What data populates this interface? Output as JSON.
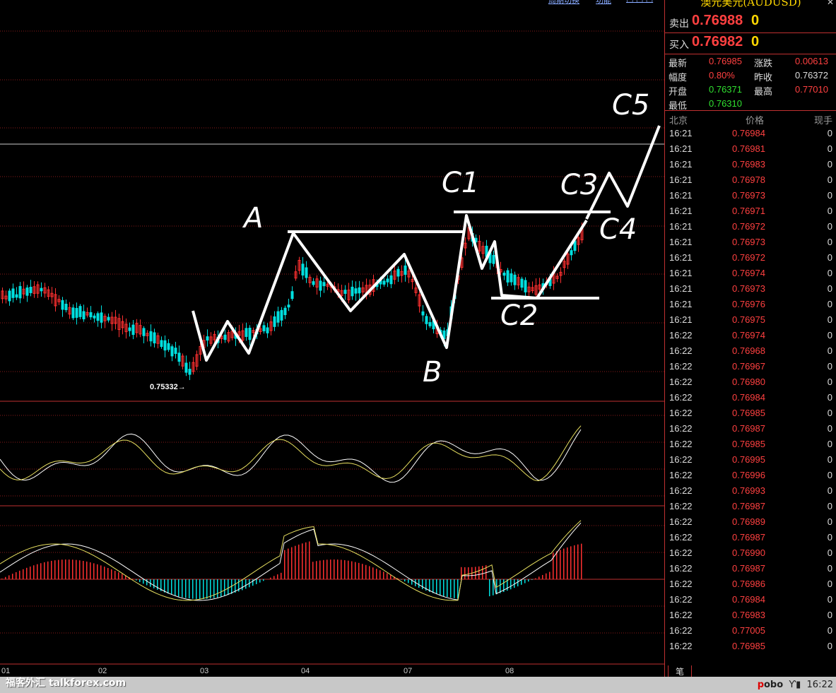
{
  "top_links": [
    "周期切换",
    "功能",
    "□ □ □"
  ],
  "right_panel": {
    "title": "澳元美元(AUDUSD)",
    "sell": {
      "label": "卖出",
      "price": "0.76988",
      "vol": "0"
    },
    "buy": {
      "label": "买入",
      "price": "0.76982",
      "vol": "0"
    },
    "stats": [
      {
        "l1": "最新",
        "v1": "0.76985",
        "c1": "#ff4040",
        "l2": "涨跌",
        "v2": "0.00613",
        "c2": "#ff4040"
      },
      {
        "l1": "幅度",
        "v1": "0.80%",
        "c1": "#ff4040",
        "l2": "昨收",
        "v2": "0.76372",
        "c2": "#dddddd"
      },
      {
        "l1": "开盘",
        "v1": "0.76371",
        "c1": "#30e030",
        "l2": "最高",
        "v2": "0.77010",
        "c2": "#ff4040"
      },
      {
        "l1": "最低",
        "v1": "0.76310",
        "c1": "#30e030",
        "l2": "",
        "v2": "",
        "c2": "#dddddd"
      }
    ],
    "ticks_header": {
      "time": "北京",
      "price": "价格",
      "vol": "现手"
    },
    "ticks": [
      {
        "t": "16:21",
        "p": "0.76984",
        "v": "0"
      },
      {
        "t": "16:21",
        "p": "0.76981",
        "v": "0"
      },
      {
        "t": "16:21",
        "p": "0.76983",
        "v": "0"
      },
      {
        "t": "16:21",
        "p": "0.76978",
        "v": "0"
      },
      {
        "t": "16:21",
        "p": "0.76973",
        "v": "0"
      },
      {
        "t": "16:21",
        "p": "0.76971",
        "v": "0"
      },
      {
        "t": "16:21",
        "p": "0.76972",
        "v": "0"
      },
      {
        "t": "16:21",
        "p": "0.76973",
        "v": "0"
      },
      {
        "t": "16:21",
        "p": "0.76972",
        "v": "0"
      },
      {
        "t": "16:21",
        "p": "0.76974",
        "v": "0"
      },
      {
        "t": "16:21",
        "p": "0.76973",
        "v": "0"
      },
      {
        "t": "16:21",
        "p": "0.76976",
        "v": "0"
      },
      {
        "t": "16:21",
        "p": "0.76975",
        "v": "0"
      },
      {
        "t": "16:22",
        "p": "0.76974",
        "v": "0"
      },
      {
        "t": "16:22",
        "p": "0.76968",
        "v": "0"
      },
      {
        "t": "16:22",
        "p": "0.76967",
        "v": "0"
      },
      {
        "t": "16:22",
        "p": "0.76980",
        "v": "0"
      },
      {
        "t": "16:22",
        "p": "0.76984",
        "v": "0"
      },
      {
        "t": "16:22",
        "p": "0.76985",
        "v": "0"
      },
      {
        "t": "16:22",
        "p": "0.76987",
        "v": "0"
      },
      {
        "t": "16:22",
        "p": "0.76985",
        "v": "0"
      },
      {
        "t": "16:22",
        "p": "0.76995",
        "v": "0"
      },
      {
        "t": "16:22",
        "p": "0.76996",
        "v": "0"
      },
      {
        "t": "16:22",
        "p": "0.76993",
        "v": "0"
      },
      {
        "t": "16:22",
        "p": "0.76987",
        "v": "0"
      },
      {
        "t": "16:22",
        "p": "0.76989",
        "v": "0"
      },
      {
        "t": "16:22",
        "p": "0.76987",
        "v": "0"
      },
      {
        "t": "16:22",
        "p": "0.76990",
        "v": "0"
      },
      {
        "t": "16:22",
        "p": "0.76987",
        "v": "0"
      },
      {
        "t": "16:22",
        "p": "0.76986",
        "v": "0"
      },
      {
        "t": "16:22",
        "p": "0.76984",
        "v": "0"
      },
      {
        "t": "16:22",
        "p": "0.76983",
        "v": "0"
      },
      {
        "t": "16:22",
        "p": "0.77005",
        "v": "0"
      },
      {
        "t": "16:22",
        "p": "0.76985",
        "v": "0"
      }
    ],
    "tab": "笔"
  },
  "chart": {
    "x_labels": [
      "01",
      "02",
      "03",
      "04",
      "07",
      "08"
    ],
    "low_marker": "0.75332→",
    "annotations": [
      "A",
      "B",
      "C1",
      "C2",
      "C3",
      "C4",
      "C5"
    ],
    "colors": {
      "up": "#ff3030",
      "down": "#00e0e0",
      "grid": "#8a1a1a",
      "drawing": "#ffffff"
    }
  },
  "status_bar": {
    "watermark": "福客外汇 talkforex.com",
    "brand_p": "p",
    "brand_rest": "obo",
    "signal_icon": "signal-icon",
    "time": "16:22"
  }
}
